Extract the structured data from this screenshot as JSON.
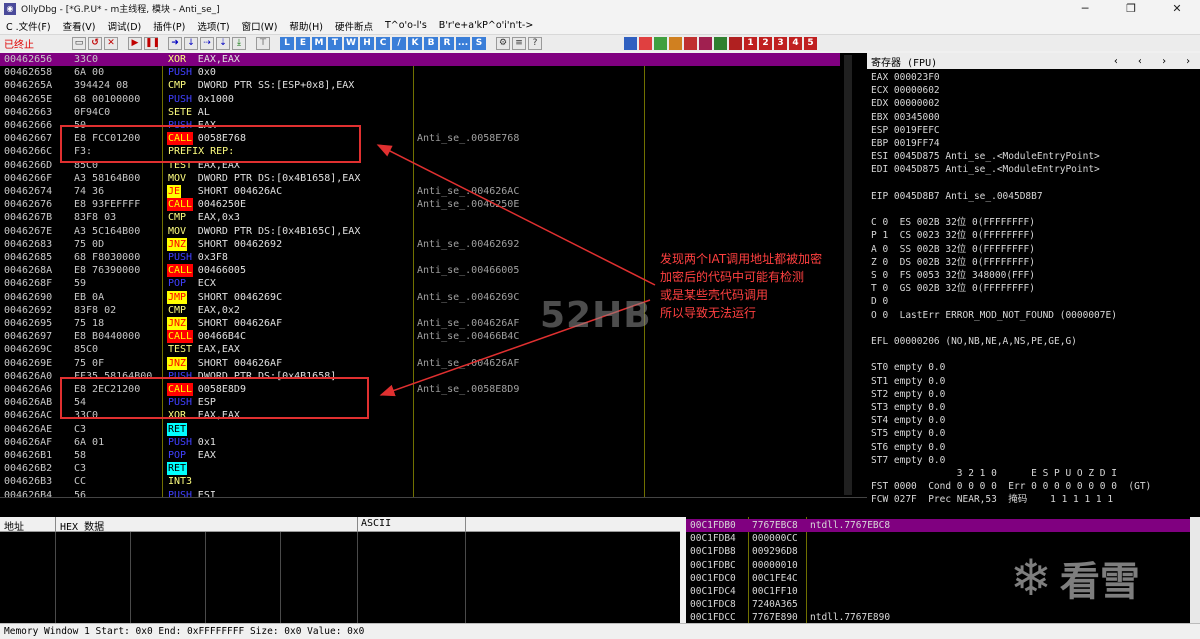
{
  "window": {
    "title": "OllyDbg - [*G.P.U* - m主线程, 模块 - Anti_se_]",
    "minimize": "─",
    "maximize": "❐",
    "close": "✕"
  },
  "menu": [
    "C .文件(F)",
    "查看(V)",
    "调试(D)",
    "插件(P)",
    "选项(T)",
    "窗口(W)",
    "帮助(H)",
    "硬件断点",
    "T^o'o-l's",
    "B'r'e+a'kP^o'i'n't->"
  ],
  "toolbar": {
    "status": "已终止",
    "letters": [
      "L",
      "E",
      "M",
      "T",
      "W",
      "H",
      "C",
      "/",
      "K",
      "B",
      "R",
      "...",
      "S"
    ],
    "numbers": [
      "1",
      "2",
      "3",
      "4",
      "5"
    ]
  },
  "disasm": [
    {
      "addr": "00462656",
      "hex": "33C0",
      "op": "XOR",
      "args": "EAX,EAX",
      "cls": "k-std",
      "sel": true
    },
    {
      "addr": "00462658",
      "hex": "6A 00",
      "op": "PUSH",
      "args": "0x0",
      "cls": "k-push"
    },
    {
      "addr": "0046265A",
      "hex": "394424 08",
      "op": "CMP",
      "args": "DWORD PTR SS:[ESP+0x8],EAX",
      "cls": "k-cmp"
    },
    {
      "addr": "0046265E",
      "hex": "68 00100000",
      "op": "PUSH",
      "args": "0x1000",
      "cls": "k-push"
    },
    {
      "addr": "00462663",
      "hex": "0F94C0",
      "op": "SETE",
      "args": "AL",
      "cls": "k-std"
    },
    {
      "addr": "00462666",
      "hex": "50",
      "op": "PUSH",
      "args": "EAX",
      "cls": "k-push"
    },
    {
      "addr": "00462667",
      "hex": "E8 FCC01200",
      "op": "CALL",
      "args": "0058E768",
      "cls": "k-call",
      "cmt": "Anti_se_.0058E768"
    },
    {
      "addr": "0046266C",
      "hex": "F3:",
      "op": "PREFIX REP:",
      "args": "",
      "cls": "k-std"
    },
    {
      "addr": "0046266D",
      "hex": "85C0",
      "op": "TEST",
      "args": "EAX,EAX",
      "cls": "k-ts"
    },
    {
      "addr": "0046266F",
      "hex": "A3 58164B00",
      "op": "MOV",
      "args": "DWORD PTR DS:[0x4B1658],EAX",
      "cls": "k-mov"
    },
    {
      "addr": "00462674",
      "hex": "74 36",
      "op": "JE",
      "args": "SHORT 004626AC",
      "cls": "k-jcc",
      "cmt": "Anti_se_.004626AC"
    },
    {
      "addr": "00462676",
      "hex": "E8 93FEFFFF",
      "op": "CALL",
      "args": "0046250E",
      "cls": "k-call",
      "cmt": "Anti_se_.0046250E"
    },
    {
      "addr": "0046267B",
      "hex": "83F8 03",
      "op": "CMP",
      "args": "EAX,0x3",
      "cls": "k-cmp"
    },
    {
      "addr": "0046267E",
      "hex": "A3 5C164B00",
      "op": "MOV",
      "args": "DWORD PTR DS:[0x4B165C],EAX",
      "cls": "k-mov"
    },
    {
      "addr": "00462683",
      "hex": "75 0D",
      "op": "JNZ",
      "args": "SHORT 00462692",
      "cls": "k-jcc",
      "cmt": "Anti_se_.00462692"
    },
    {
      "addr": "00462685",
      "hex": "68 F8030000",
      "op": "PUSH",
      "args": "0x3F8",
      "cls": "k-push"
    },
    {
      "addr": "0046268A",
      "hex": "E8 76390000",
      "op": "CALL",
      "args": "00466005",
      "cls": "k-call",
      "cmt": "Anti_se_.00466005"
    },
    {
      "addr": "0046268F",
      "hex": "59",
      "op": "POP",
      "args": "ECX",
      "cls": "k-push"
    },
    {
      "addr": "00462690",
      "hex": "EB 0A",
      "op": "JMP",
      "args": "SHORT 0046269C",
      "cls": "k-jcc",
      "cmt": "Anti_se_.0046269C"
    },
    {
      "addr": "00462692",
      "hex": "83F8 02",
      "op": "CMP",
      "args": "EAX,0x2",
      "cls": "k-cmp"
    },
    {
      "addr": "00462695",
      "hex": "75 18",
      "op": "JNZ",
      "args": "SHORT 004626AF",
      "cls": "k-jcc",
      "cmt": "Anti_se_.004626AF"
    },
    {
      "addr": "00462697",
      "hex": "E8 B0440000",
      "op": "CALL",
      "args": "00466B4C",
      "cls": "k-call",
      "cmt": "Anti_se_.00466B4C"
    },
    {
      "addr": "0046269C",
      "hex": "85C0",
      "op": "TEST",
      "args": "EAX,EAX",
      "cls": "k-ts"
    },
    {
      "addr": "0046269E",
      "hex": "75 0F",
      "op": "JNZ",
      "args": "SHORT 004626AF",
      "cls": "k-jcc",
      "cmt": "Anti_se_.004626AF"
    },
    {
      "addr": "004626A0",
      "hex": "FF35 58164B00",
      "op": "PUSH",
      "args": "DWORD PTR DS:[0x4B1658]",
      "cls": "k-push"
    },
    {
      "addr": "004626A6",
      "hex": "E8 2EC21200",
      "op": "CALL",
      "args": "0058E8D9",
      "cls": "k-call",
      "cmt": "Anti_se_.0058E8D9"
    },
    {
      "addr": "004626AB",
      "hex": "54",
      "op": "PUSH",
      "args": "ESP",
      "cls": "k-push"
    },
    {
      "addr": "004626AC",
      "hex": "33C0",
      "op": "XOR",
      "args": "EAX,EAX",
      "cls": "k-std"
    },
    {
      "addr": "004626AE",
      "hex": "C3",
      "op": "RET",
      "args": "",
      "cls": "k-ret"
    },
    {
      "addr": "004626AF",
      "hex": "6A 01",
      "op": "PUSH",
      "args": "0x1",
      "cls": "k-push"
    },
    {
      "addr": "004626B1",
      "hex": "58",
      "op": "POP",
      "args": "EAX",
      "cls": "k-push"
    },
    {
      "addr": "004626B2",
      "hex": "C3",
      "op": "RET",
      "args": "",
      "cls": "k-ret"
    },
    {
      "addr": "004626B3",
      "hex": "CC",
      "op": "INT3",
      "args": "",
      "cls": "k-std"
    },
    {
      "addr": "004626B4",
      "hex": "56",
      "op": "PUSH",
      "args": "ESI",
      "cls": "k-push"
    }
  ],
  "registers": {
    "title": "寄存器 (FPU)",
    "lines": [
      "EAX 000023F0",
      "ECX 00000602",
      "EDX 00000002",
      "EBX 00345000",
      "ESP 0019FEFC",
      "EBP 0019FF74",
      "ESI 0045D875 Anti_se_.<ModuleEntryPoint>",
      "EDI 0045D875 Anti_se_.<ModuleEntryPoint>",
      "",
      "EIP 0045D8B7 Anti_se_.0045D8B7",
      "",
      "C 0  ES 002B 32位 0(FFFFFFFF)",
      "P 1  CS 0023 32位 0(FFFFFFFF)",
      "A 0  SS 002B 32位 0(FFFFFFFF)",
      "Z 0  DS 002B 32位 0(FFFFFFFF)",
      "S 0  FS 0053 32位 348000(FFF)",
      "T 0  GS 002B 32位 0(FFFFFFFF)",
      "D 0",
      "O 0  LastErr ERROR_MOD_NOT_FOUND (0000007E)",
      "",
      "EFL 00000206 (NO,NB,NE,A,NS,PE,GE,G)",
      "",
      "ST0 empty 0.0",
      "ST1 empty 0.0",
      "ST2 empty 0.0",
      "ST3 empty 0.0",
      "ST4 empty 0.0",
      "ST5 empty 0.0",
      "ST6 empty 0.0",
      "ST7 empty 0.0",
      "               3 2 1 0      E S P U O Z D I",
      "FST 0000  Cond 0 0 0 0  Err 0 0 0 0 0 0 0 0  (GT)",
      "FCW 027F  Prec NEAR,53  掩码    1 1 1 1 1 1"
    ]
  },
  "dump": {
    "col_addr": "地址",
    "col_hex": "HEX 数据",
    "col_ascii": "ASCII"
  },
  "stack": [
    {
      "addr": "00C1FDB0",
      "val": "7767EBC8",
      "cmt": "ntdll.7767EBC8",
      "sel": true
    },
    {
      "addr": "00C1FDB4",
      "val": "000000CC",
      "cmt": ""
    },
    {
      "addr": "00C1FDB8",
      "val": "009296D8",
      "cmt": ""
    },
    {
      "addr": "00C1FDBC",
      "val": "00000010",
      "cmt": ""
    },
    {
      "addr": "00C1FDC0",
      "val": "00C1FE4C",
      "cmt": ""
    },
    {
      "addr": "00C1FDC4",
      "val": "00C1FF10",
      "cmt": ""
    },
    {
      "addr": "00C1FDC8",
      "val": "7240A365",
      "cmt": ""
    },
    {
      "addr": "00C1FDCC",
      "val": "7767E890",
      "cmt": "ntdll.7767E890"
    }
  ],
  "statusbar": "Memory Window 1  Start: 0x0  End: 0xFFFFFFFF  Size: 0x0 Value: 0x0",
  "annotation": [
    "发现两个IAT调用地址都被加密",
    "加密后的代码中可能有检测",
    "或是某些壳代码调用",
    "所以导致无法运行"
  ],
  "watermark": "52HB",
  "logo_text": "看雪",
  "colors": {
    "selection": "#800080",
    "annot": "#ff4040",
    "box": "#e03030"
  }
}
